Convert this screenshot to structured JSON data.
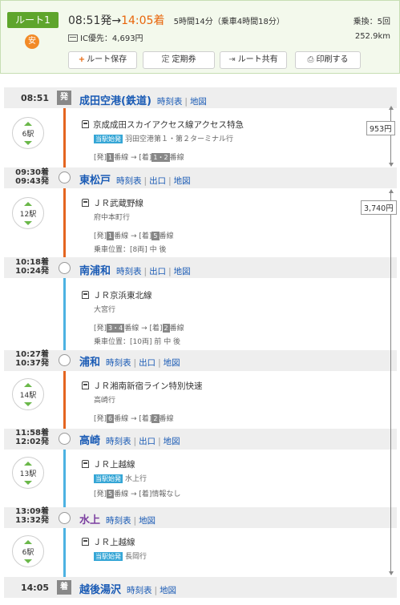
{
  "header": {
    "route_label": "ルート1",
    "route_icon": "安",
    "dep_time": "08:51発",
    "arrow": "→",
    "arr_time": "14:05着",
    "duration": "5時間14分（乗車4時間18分）",
    "fare": "IC優先：4,693円",
    "transfer": "乗換：5回",
    "distance": "252.9km",
    "buttons": {
      "save_icon": "+",
      "save": "ルート保存",
      "pass_icon": "定",
      "pass": "定期券",
      "share_icon": "⇥",
      "share": "ルート共有",
      "print_icon": "⎙",
      "print": "印刷する"
    }
  },
  "link_labels": {
    "timetable": "時刻表",
    "exit": "出口",
    "map": "地図",
    "sep": "|"
  },
  "stations": [
    {
      "time": "08:51",
      "mark": "発",
      "name": "成田空港(鉄道)"
    },
    {
      "time_arr": "09:30着",
      "time_dep": "09:43発",
      "name": "東松戸"
    },
    {
      "time_arr": "10:18着",
      "time_dep": "10:24発",
      "name": "南浦和"
    },
    {
      "time_arr": "10:27着",
      "time_dep": "10:37発",
      "name": "浦和"
    },
    {
      "time_arr": "11:58着",
      "time_dep": "12:02発",
      "name": "高崎"
    },
    {
      "time_arr": "13:09着",
      "time_dep": "13:32発",
      "name": "水上"
    },
    {
      "time": "14:05",
      "mark": "着",
      "name": "越後湯沢"
    }
  ],
  "segments": [
    {
      "stops": "6駅",
      "line": "京成成田スカイアクセス線アクセス特急",
      "origin_badge": "当駅始発",
      "dest": "羽田空港第１・第２ターミナル行",
      "dep_label": "[発]",
      "dep_track": "1",
      "track_mid": "番線 → [着]",
      "arr_track": "1・2",
      "track_end": "番線"
    },
    {
      "stops": "12駅",
      "line": "ＪＲ武蔵野線",
      "dest": "府中本町行",
      "dep_label": "[発]",
      "dep_track": "1",
      "track_mid": "番線 → [着]",
      "arr_track": "5",
      "track_end": "番線",
      "position": "乗車位置：[8両] 中 後"
    },
    {
      "line": "ＪＲ京浜東北線",
      "dest": "大宮行",
      "dep_label": "[発]",
      "dep_track": "3・4",
      "track_mid": "番線 → [着]",
      "arr_track": "2",
      "track_end": "番線",
      "position": "乗車位置：[10両] 前 中 後"
    },
    {
      "stops": "14駅",
      "line": "ＪＲ湘南新宿ライン特別快速",
      "dest": "高崎行",
      "dep_label": "[発]",
      "dep_track": "6",
      "track_mid": "番線 → [着]",
      "arr_track": "2",
      "track_end": "番線"
    },
    {
      "stops": "13駅",
      "line": "ＪＲ上越線",
      "origin_badge": "当駅始発",
      "dest": "水上行",
      "dep_label": "[発]",
      "dep_track": "5",
      "track_mid": "番線 → [着]",
      "track_end": "情報なし"
    },
    {
      "stops": "6駅",
      "line": "ＪＲ上越線",
      "origin_badge": "当駅始発",
      "dest": "長岡行"
    }
  ],
  "fares": [
    "953円",
    "3,740円"
  ],
  "colors": {
    "orange_line": "#e46520",
    "blue_line": "#4db2e2",
    "arrival_time": "#e8650a",
    "link": "#1a5bb5"
  }
}
